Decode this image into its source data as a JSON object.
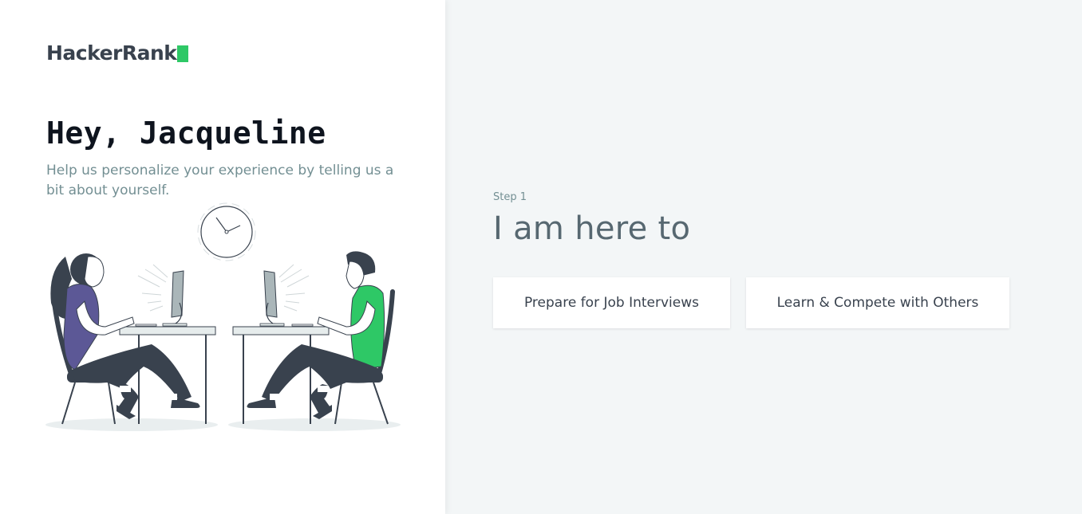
{
  "brand": {
    "name": "HackerRank",
    "accent_color": "#2ec866"
  },
  "intro": {
    "greeting": "Hey, Jacqueline",
    "subtitle": "Help us personalize your experience by telling us a bit about yourself."
  },
  "illustration": {
    "icon": "two-people-coding-at-desks-with-clock"
  },
  "onboarding": {
    "step_label": "Step 1",
    "question": "I am here to",
    "options": [
      {
        "label": "Prepare for Job Interviews"
      },
      {
        "label": "Learn & Compete with Others"
      }
    ]
  }
}
